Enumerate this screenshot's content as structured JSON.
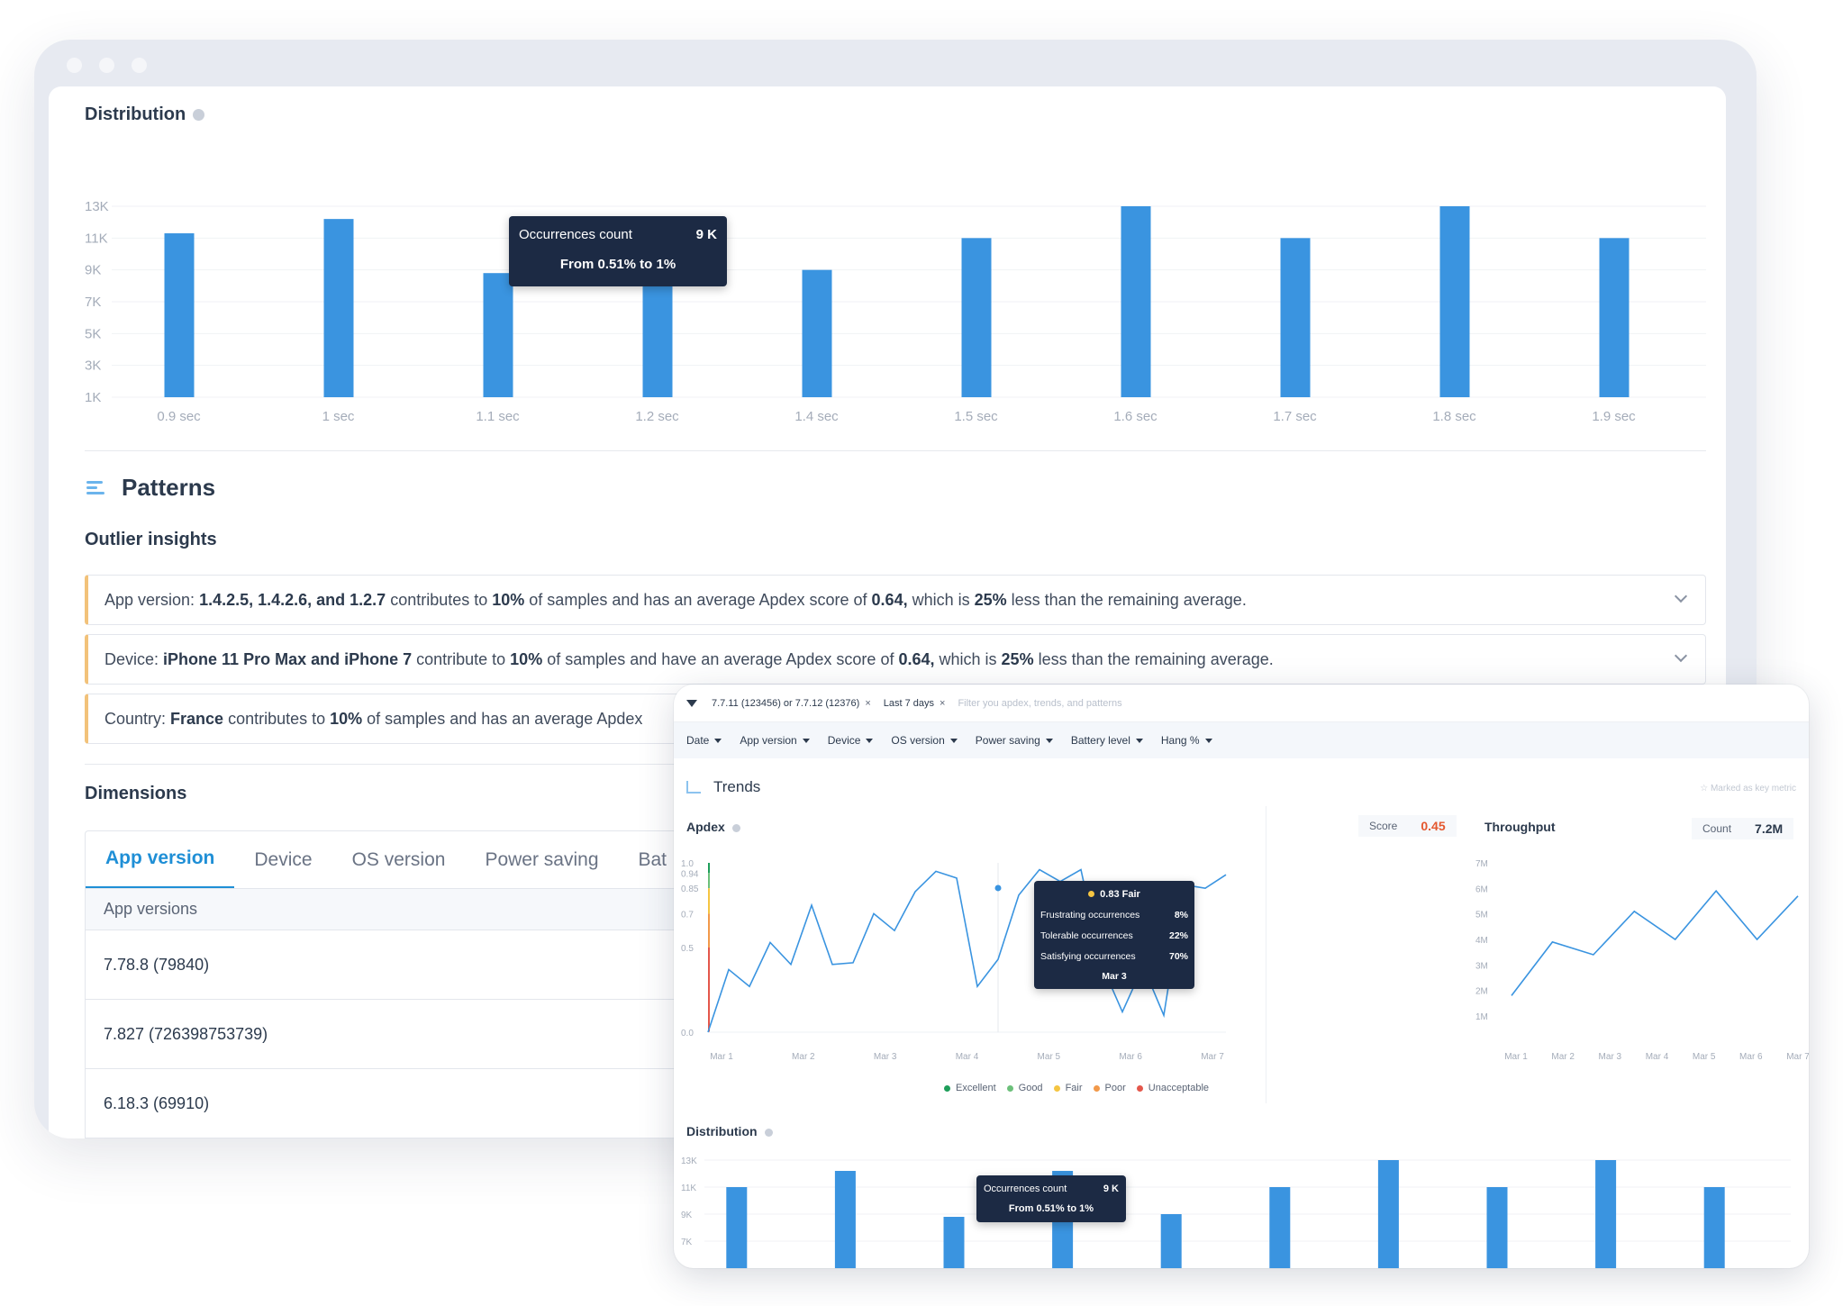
{
  "back": {
    "distribution_title": "Distribution",
    "patterns_title": "Patterns",
    "outlier_title": "Outlier insights",
    "insights": [
      {
        "pre": "App version:",
        "bold": "1.4.2.5, 1.4.2.6, and 1.2.7",
        "mid": "contributes to",
        "b2": "10%",
        "mid2": "of samples and has an average Apdex score of",
        "b3": "0.64,",
        "mid3": "which is",
        "b4": "25%",
        "post": "less than the remaining average."
      },
      {
        "pre": "Device:",
        "bold": "iPhone 11 Pro Max and iPhone 7",
        "mid": "contribute to",
        "b2": "10%",
        "mid2": "of samples and have an average Apdex score of",
        "b3": "0.64,",
        "mid3": "which is",
        "b4": "25%",
        "post": "less than the remaining average."
      },
      {
        "pre": "Country:",
        "bold": "France",
        "mid": "contributes to",
        "b2": "10%",
        "mid2": "of samples and has an average Apdex",
        "b3": "",
        "mid3": "",
        "b4": "",
        "post": ""
      }
    ],
    "dimensions_title": "Dimensions",
    "tabs": [
      "App version",
      "Device",
      "OS version",
      "Power saving",
      "Bat"
    ],
    "table_header": "App versions",
    "rows": [
      "7.78.8 (79840)",
      "7.827 (726398753739)",
      "6.18.3 (69910)"
    ],
    "tooltip": {
      "label": "Occurrences count",
      "value": "9 K",
      "range": "From 0.51% to 1%"
    }
  },
  "chart_data": [
    {
      "type": "bar",
      "title": "Distribution",
      "categories": [
        "0.9 sec",
        "1 sec",
        "1.1 sec",
        "1.2 sec",
        "1.4 sec",
        "1.5 sec",
        "1.6 sec",
        "1.7 sec",
        "1.8 sec",
        "1.9 sec"
      ],
      "values": [
        11300,
        12200,
        8800,
        12200,
        9000,
        11000,
        13000,
        11000,
        13000,
        11000
      ],
      "y_ticks": [
        "13K",
        "11K",
        "9K",
        "7K",
        "5K",
        "3K",
        "1K"
      ],
      "ylim": [
        1000,
        13000
      ],
      "grid": true
    },
    {
      "type": "line",
      "title": "Apdex",
      "x_labels": [
        "Mar 1",
        "Mar 2",
        "Mar 3",
        "Mar 4",
        "Mar 5",
        "Mar 6",
        "Mar 7"
      ],
      "values": [
        0.0,
        0.37,
        0.27,
        0.53,
        0.4,
        0.75,
        0.4,
        0.41,
        0.7,
        0.6,
        0.83,
        0.95,
        0.91,
        0.27,
        0.43,
        0.81,
        0.96,
        0.89,
        0.96,
        0.4,
        0.12,
        0.39,
        0.1,
        0.87,
        0.85,
        0.93
      ],
      "y_ticks": [
        "1.0",
        "0.94",
        "0.85",
        "0.7",
        "0.5",
        "0.0"
      ],
      "ylim": [
        0,
        1
      ],
      "score_label": "Score",
      "score_value": "0.45",
      "legend": [
        {
          "label": "Excellent",
          "color": "#1e9e5a"
        },
        {
          "label": "Good",
          "color": "#6cc07a"
        },
        {
          "label": "Fair",
          "color": "#f5c542"
        },
        {
          "label": "Poor",
          "color": "#f2994a"
        },
        {
          "label": "Unacceptable",
          "color": "#e4574b"
        }
      ],
      "tooltip": {
        "title": "0.83 Fair",
        "rows": [
          [
            "Frustrating occurrences",
            "8%"
          ],
          [
            "Tolerable occurrences",
            "22%"
          ],
          [
            "Satisfying occurrences",
            "70%"
          ]
        ],
        "date": "Mar 3"
      }
    },
    {
      "type": "line",
      "title": "Throughput",
      "x_labels": [
        "Mar 1",
        "Mar 2",
        "Mar 3",
        "Mar 4",
        "Mar 5",
        "Mar 6",
        "Mar 7"
      ],
      "values": [
        1.8,
        3.9,
        3.4,
        5.1,
        4.0,
        5.9,
        4.0,
        5.7
      ],
      "y_ticks": [
        "7M",
        "6M",
        "5M",
        "4M",
        "3M",
        "2M",
        "1M"
      ],
      "ylim": [
        1,
        7
      ],
      "count_label": "Count",
      "count_value": "7.2M"
    },
    {
      "type": "bar",
      "title": "Distribution",
      "values": [
        11000,
        12200,
        8800,
        12200,
        9000,
        11000,
        13000,
        11000,
        13000,
        11000
      ],
      "y_ticks": [
        "13K",
        "11K",
        "9K",
        "7K"
      ],
      "ylim": [
        5000,
        13000
      ],
      "tooltip": {
        "label": "Occurrences count",
        "value": "9 K",
        "range": "From 0.51% to 1%"
      }
    }
  ],
  "front": {
    "filter_chips": [
      "7.7.11 (123456) or 7.7.12 (12376)",
      "Last 7 days"
    ],
    "filter_placeholder": "Filter you apdex, trends, and patterns",
    "dropdowns": [
      "Date",
      "App version",
      "Device",
      "OS version",
      "Power saving",
      "Battery level",
      "Hang %"
    ],
    "trends_title": "Trends",
    "key_metric": "Marked as key metric",
    "apdex_label": "Apdex",
    "throughput_label": "Throughput",
    "distribution_label": "Distribution"
  }
}
